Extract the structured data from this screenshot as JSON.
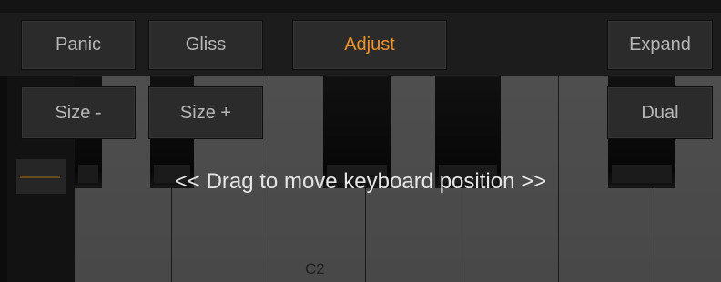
{
  "toolbar": {
    "panic_label": "Panic",
    "gliss_label": "Gliss",
    "adjust_label": "Adjust",
    "expand_label": "Expand",
    "size_minus_label": "Size -",
    "size_plus_label": "Size +",
    "dual_label": "Dual"
  },
  "keyboard": {
    "drag_hint": "<< Drag to move keyboard position >>",
    "note_label": "C2"
  },
  "colors": {
    "background": "#141414",
    "white_key": "#4b4b4b",
    "black_key": "#0b0b0b",
    "button_bg": "#2b2b2b",
    "button_text": "#b7b7b7",
    "active_text": "#f0932a",
    "indicator": "#6a4a1a"
  },
  "active_button": "adjust"
}
